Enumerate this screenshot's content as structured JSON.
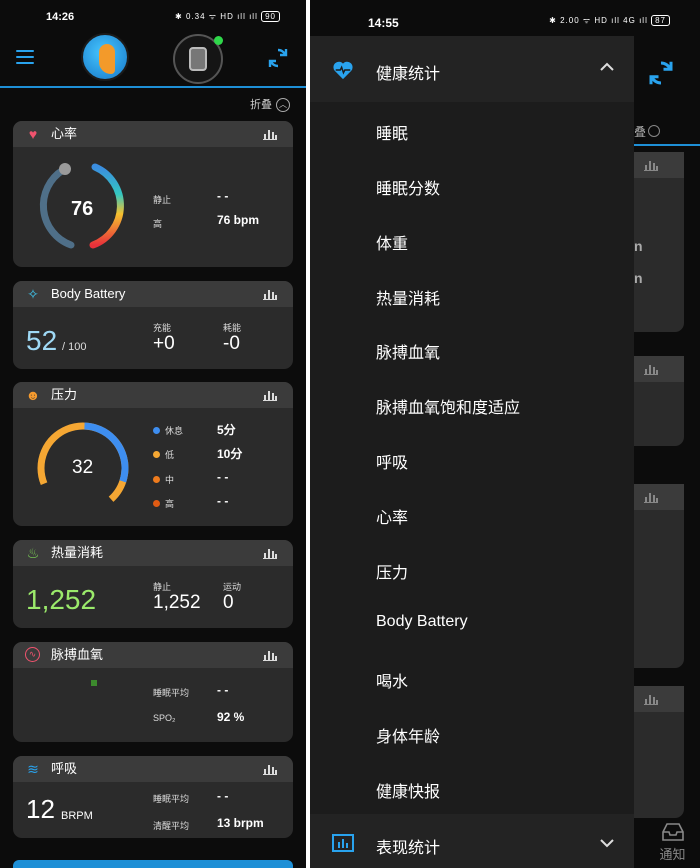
{
  "left": {
    "status": {
      "time": "14:26",
      "icons": "✱ 0.34 ᯤ HD ıll ıll",
      "battery": "90"
    },
    "collapse_label": "折叠",
    "heart": {
      "title": "心率",
      "value": "76",
      "rest_label": "静止",
      "rest_value": "- -",
      "high_label": "高",
      "high_value": "76 bpm"
    },
    "battery": {
      "title": "Body Battery",
      "value": "52",
      "max": "/ 100",
      "charge_label": "充能",
      "charge_value": "+0",
      "drain_label": "耗能",
      "drain_value": "-0"
    },
    "stress": {
      "title": "压力",
      "value": "32",
      "rows": [
        {
          "label": "休息",
          "value": "5分",
          "color": "#3e8ef0"
        },
        {
          "label": "低",
          "value": "10分",
          "color": "#f5a733"
        },
        {
          "label": "中",
          "value": "- -",
          "color": "#ee7b1d"
        },
        {
          "label": "高",
          "value": "- -",
          "color": "#e05b13"
        }
      ]
    },
    "calories": {
      "title": "热量消耗",
      "value": "1,252",
      "rest_label": "静止",
      "rest_value": "1,252",
      "active_label": "运动",
      "active_value": "0"
    },
    "pulse": {
      "title": "脉搏血氧",
      "sleep_label": "睡眠平均",
      "sleep_value": "- -",
      "spo2_label": "SPO₂",
      "spo2_value": "92 %"
    },
    "resp": {
      "title": "呼吸",
      "value": "12",
      "unit": "BRPM",
      "sleep_label": "睡眠平均",
      "sleep_value": "- -",
      "awake_label": "清醒平均",
      "awake_value": "13 brpm"
    }
  },
  "right": {
    "status": {
      "time": "14:55",
      "icons": "✱ 2.00 ᯤ HD ıll 4G ıll",
      "battery": "87"
    },
    "drawer_header": "健康统计",
    "items": [
      "睡眠",
      "睡眠分数",
      "体重",
      "热量消耗",
      "脉搏血氧",
      "脉搏血氧饱和度适应",
      "呼吸",
      "心率",
      "压力",
      "Body Battery",
      "喝水",
      "身体年龄",
      "健康快报"
    ],
    "drawer_footer": "表现统计",
    "bg_fragments": {
      "collapse": "叠",
      "n1": "n",
      "n2": "n",
      "notify": "通知"
    }
  }
}
